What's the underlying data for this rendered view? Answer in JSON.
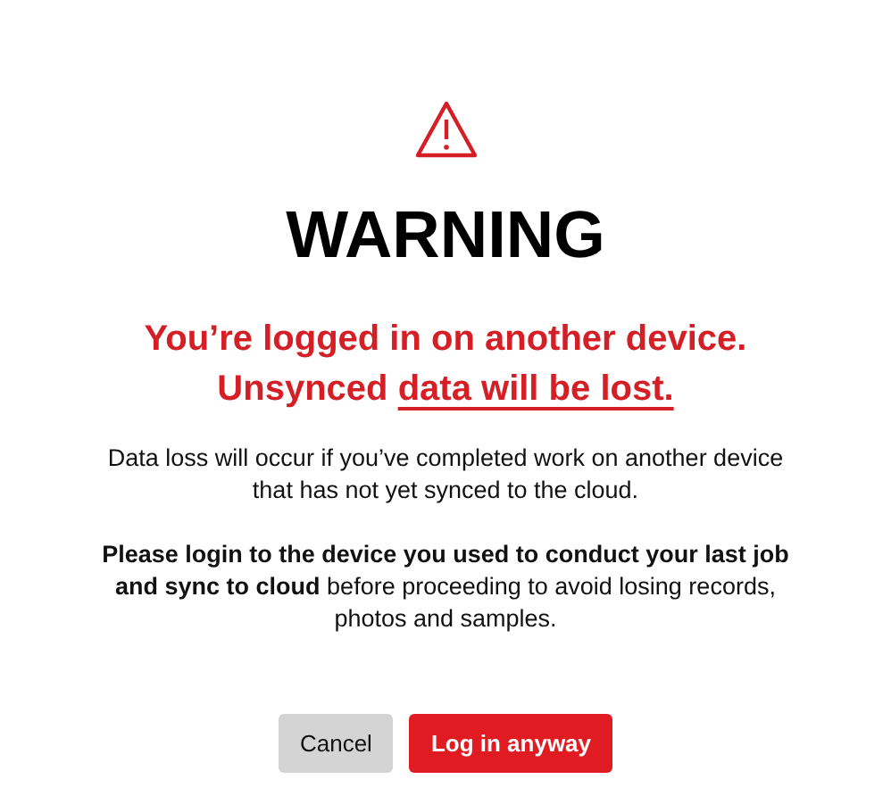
{
  "title": "WARNING",
  "headline_lines": [
    [
      {
        "text": "You’re logged in on another device.",
        "underlined": false
      }
    ],
    [
      {
        "text": "Unsynced ",
        "underlined": false
      },
      {
        "text": "data will be lost.",
        "underlined": true
      }
    ]
  ],
  "paragraphs": [
    "Data loss will occur if you’ve completed work on another device that has not yet synced to the cloud.",
    "**Please login to the device you used to conduct your last job and sync to cloud** before proceeding to avoid losing records, photos and samples."
  ],
  "buttons": [
    {
      "label": "Cancel",
      "kind": "secondary"
    },
    {
      "label": "Log in anyway",
      "kind": "primary"
    }
  ]
}
